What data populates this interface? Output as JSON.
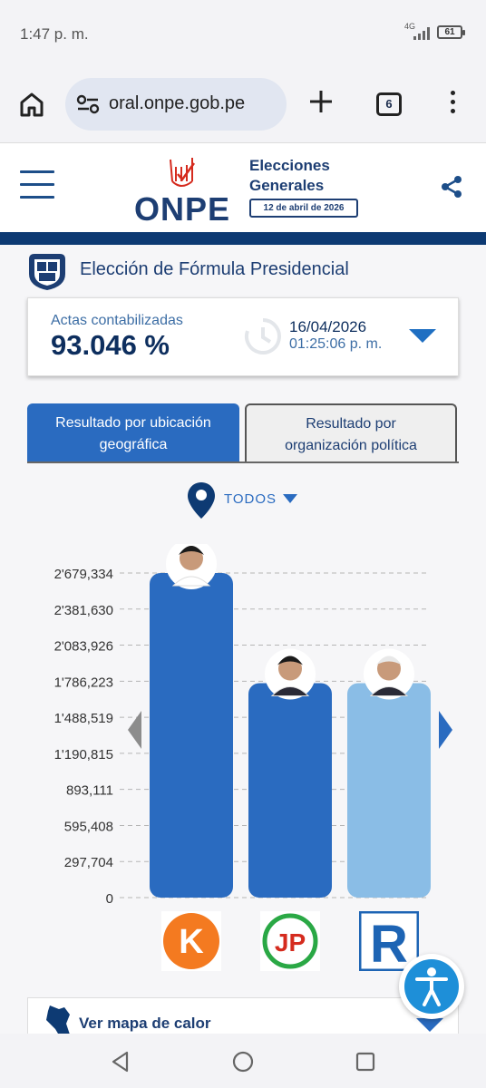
{
  "status": {
    "time": "1:47 p. m.",
    "network": "4G",
    "battery": "61"
  },
  "browser": {
    "url": "oral.onpe.gob.pe",
    "tab_count": "6"
  },
  "header": {
    "logo_text": "ONPE",
    "election_title_line1": "Elecciones",
    "election_title_line2": "Generales",
    "election_date": "12 de abril de 2026"
  },
  "section": {
    "title": "Elección de Fórmula Presidencial"
  },
  "actas": {
    "label": "Actas contabilizadas",
    "percent": "93.046 %",
    "date": "16/04/2026",
    "time": "01:25:06 p. m."
  },
  "tabs": {
    "geo_line1": "Resultado por ubicación",
    "geo_line2": "geográfica",
    "org_line1": "Resultado por",
    "org_line2": "organización política"
  },
  "filter": {
    "location": "TODOS"
  },
  "chart_data": {
    "type": "bar",
    "categories": [
      "Fuerza Popular",
      "Juntos por el Perú",
      "Renovación Popular"
    ],
    "values": [
      2679334,
      1770000,
      1770000
    ],
    "yticks": [
      "0",
      "297,704",
      "595,408",
      "893,111",
      "1'190,815",
      "1'488,519",
      "1'786,223",
      "2'083,926",
      "2'381,630",
      "2'679,334"
    ],
    "ylim": [
      0,
      2679334
    ],
    "colors": [
      "#2a6bc0",
      "#2a6bc0",
      "#8abde6"
    ],
    "grid": true
  },
  "parties": {
    "k_letter": "K",
    "jp_letters": "JP",
    "r_letter": "R"
  },
  "heatmap": {
    "label": "Ver mapa de calor"
  },
  "colors": {
    "navy": "#0d3a73",
    "accent": "#2a6bc0",
    "light_bar": "#8abde6"
  }
}
